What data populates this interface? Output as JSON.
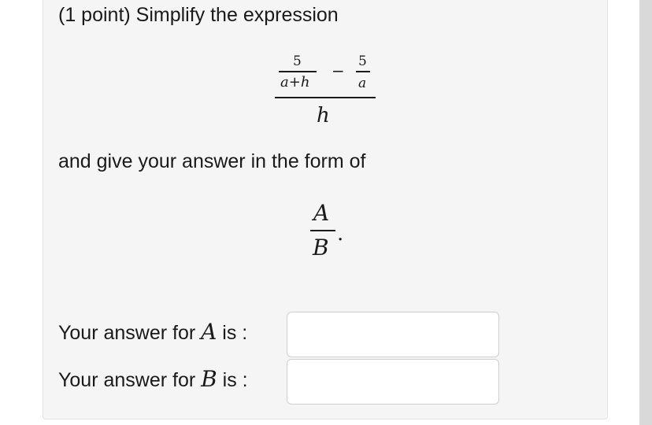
{
  "problem": {
    "intro": "(1 point) Simplify the expression",
    "instruction": "and give your answer in the form of"
  },
  "expression": {
    "frac1_num": "5",
    "frac1_den": "a+h",
    "minus": "−",
    "frac2_num": "5",
    "frac2_den": "a",
    "outer_den": "h"
  },
  "form": {
    "numerator": "A",
    "denominator": "B",
    "period": "."
  },
  "answers": {
    "a": {
      "prefix": "Your answer for ",
      "var": "A",
      "suffix": " is :",
      "value": ""
    },
    "b": {
      "prefix": "Your answer for ",
      "var": "B",
      "suffix": " is :",
      "value": ""
    }
  }
}
